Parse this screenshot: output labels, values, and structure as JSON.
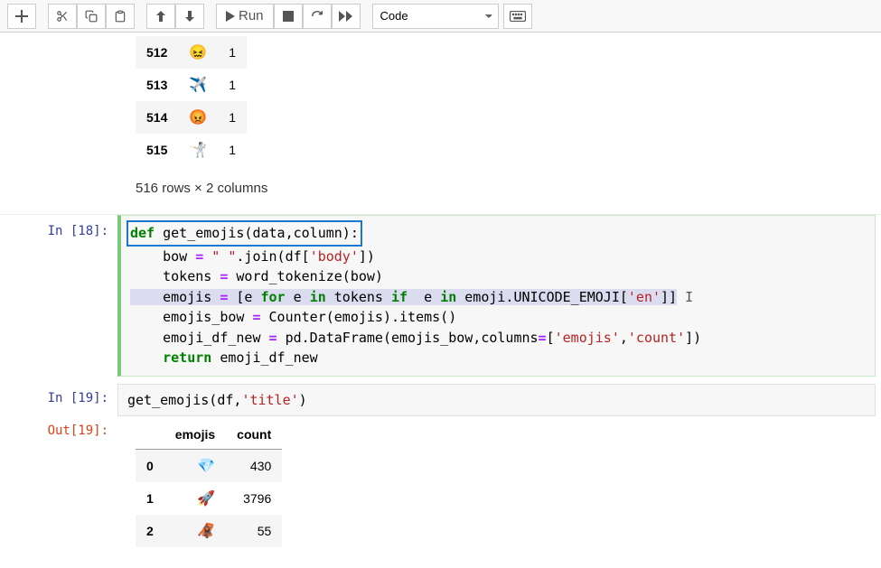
{
  "toolbar": {
    "run_label": "Run",
    "celltype": "Code"
  },
  "output_above": {
    "rows": [
      {
        "idx": "512",
        "emoji": "😖",
        "count": "1"
      },
      {
        "idx": "513",
        "emoji": "✈️",
        "count": "1"
      },
      {
        "idx": "514",
        "emoji": "😡",
        "count": "1"
      },
      {
        "idx": "515",
        "emoji": "🤺",
        "count": "1"
      }
    ],
    "footer": "516 rows × 2 columns"
  },
  "cell18": {
    "prompt": "In [18]:",
    "code": {
      "l1_def": "def",
      "l1_rest": " get_emojis(data,column):",
      "l2_pre": "    bow ",
      "l2_op": "=",
      "l2_s1": " \" \"",
      "l2_mid": ".join(df[",
      "l2_s2": "'body'",
      "l2_end": "])",
      "l3_pre": "    tokens ",
      "l3_op": "=",
      "l3_end": " word_tokenize(bow)",
      "l4_pre": "    emojis ",
      "l4_op": "=",
      "l4_a": " [e ",
      "l4_for": "for",
      "l4_b": " e ",
      "l4_in1": "in",
      "l4_c": " tokens ",
      "l4_if": "if",
      "l4_d": "  e ",
      "l4_in2": "in",
      "l4_e": " emoji.UNICODE_EMOJI[",
      "l4_s": "'en'",
      "l4_f": "]]",
      "l5_pre": "    emojis_bow ",
      "l5_op": "=",
      "l5_end": " Counter(emojis).items()",
      "l6_pre": "    emoji_df_new ",
      "l6_op": "=",
      "l6_a": " pd.DataFrame(emojis_bow,columns",
      "l6_op2": "=",
      "l6_b": "[",
      "l6_s1": "'emojis'",
      "l6_c": ",",
      "l6_s2": "'count'",
      "l6_d": "])",
      "l7_ret": "    return",
      "l7_end": " emoji_df_new"
    }
  },
  "cell19": {
    "prompt_in": "In [19]:",
    "prompt_out": "Out[19]:",
    "code_pre": "get_emojis(df,",
    "code_str": "'title'",
    "code_end": ")",
    "table": {
      "cols": [
        "emojis",
        "count"
      ],
      "rows": [
        {
          "idx": "0",
          "emoji": "💎",
          "count": "430"
        },
        {
          "idx": "1",
          "emoji": "🚀",
          "count": "3796"
        },
        {
          "idx": "2",
          "emoji": "🦧",
          "count": "55"
        }
      ]
    }
  }
}
